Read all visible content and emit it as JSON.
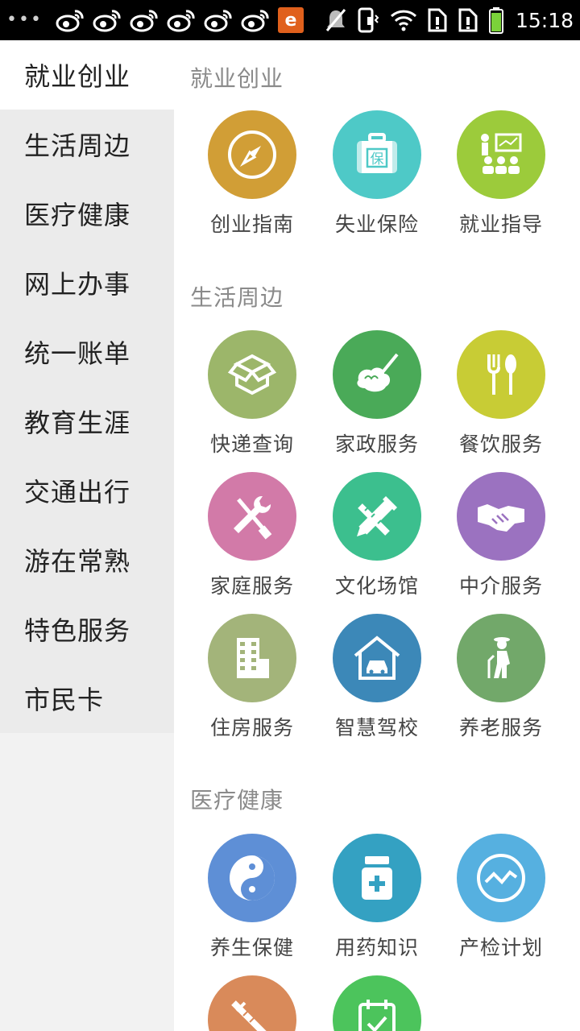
{
  "status_bar": {
    "time": "15:18",
    "browser_badge": "e",
    "icons": [
      "more-dots-icon",
      "weibo-icon",
      "weibo-icon",
      "weibo-icon",
      "weibo-icon",
      "weibo-icon",
      "weibo-icon",
      "browser-icon",
      "mute-icon",
      "phone-vibrate-icon",
      "wifi-icon",
      "sim-alert-icon",
      "sim-alert-icon",
      "battery-icon"
    ]
  },
  "sidebar": {
    "items": [
      {
        "label": "就业创业",
        "active": true
      },
      {
        "label": "生活周边",
        "active": false
      },
      {
        "label": "医疗健康",
        "active": false
      },
      {
        "label": "网上办事",
        "active": false
      },
      {
        "label": "统一账单",
        "active": false
      },
      {
        "label": "教育生涯",
        "active": false
      },
      {
        "label": "交通出行",
        "active": false
      },
      {
        "label": "游在常熟",
        "active": false
      },
      {
        "label": "特色服务",
        "active": false
      },
      {
        "label": "市民卡",
        "active": false
      }
    ]
  },
  "sections": [
    {
      "title": "就业创业",
      "items": [
        {
          "label": "创业指南",
          "color": "#d19e36",
          "icon": "compass-icon"
        },
        {
          "label": "失业保险",
          "color": "#4ec9c7",
          "icon": "insurance-case-icon"
        },
        {
          "label": "就业指导",
          "color": "#9ccb3b",
          "icon": "teacher-board-icon"
        }
      ]
    },
    {
      "title": "生活周边",
      "items": [
        {
          "label": "快递查询",
          "color": "#9cb66a",
          "icon": "package-box-icon"
        },
        {
          "label": "家政服务",
          "color": "#4aaa58",
          "icon": "cleaning-duster-icon"
        },
        {
          "label": "餐饮服务",
          "color": "#c8cc35",
          "icon": "fork-spoon-icon"
        },
        {
          "label": "家庭服务",
          "color": "#d27aa8",
          "icon": "wrench-screwdriver-icon"
        },
        {
          "label": "文化场馆",
          "color": "#3cbf8e",
          "icon": "pencil-ruler-icon"
        },
        {
          "label": "中介服务",
          "color": "#9b72c0",
          "icon": "handshake-icon"
        },
        {
          "label": "住房服务",
          "color": "#a3b47a",
          "icon": "building-icon"
        },
        {
          "label": "智慧驾校",
          "color": "#3c88b8",
          "icon": "car-garage-icon"
        },
        {
          "label": "养老服务",
          "color": "#72a86a",
          "icon": "elderly-cane-icon"
        }
      ]
    },
    {
      "title": "医疗健康",
      "items": [
        {
          "label": "养生保健",
          "color": "#5e8fd6",
          "icon": "yin-yang-icon"
        },
        {
          "label": "用药知识",
          "color": "#34a1c2",
          "icon": "medicine-bottle-icon"
        },
        {
          "label": "产检计划",
          "color": "#56b0e0",
          "icon": "heartbeat-monitor-icon"
        },
        {
          "label": "",
          "color": "#d98a5a",
          "icon": "syringe-icon"
        },
        {
          "label": "",
          "color": "#4cc45c",
          "icon": "calendar-check-icon"
        }
      ]
    }
  ]
}
